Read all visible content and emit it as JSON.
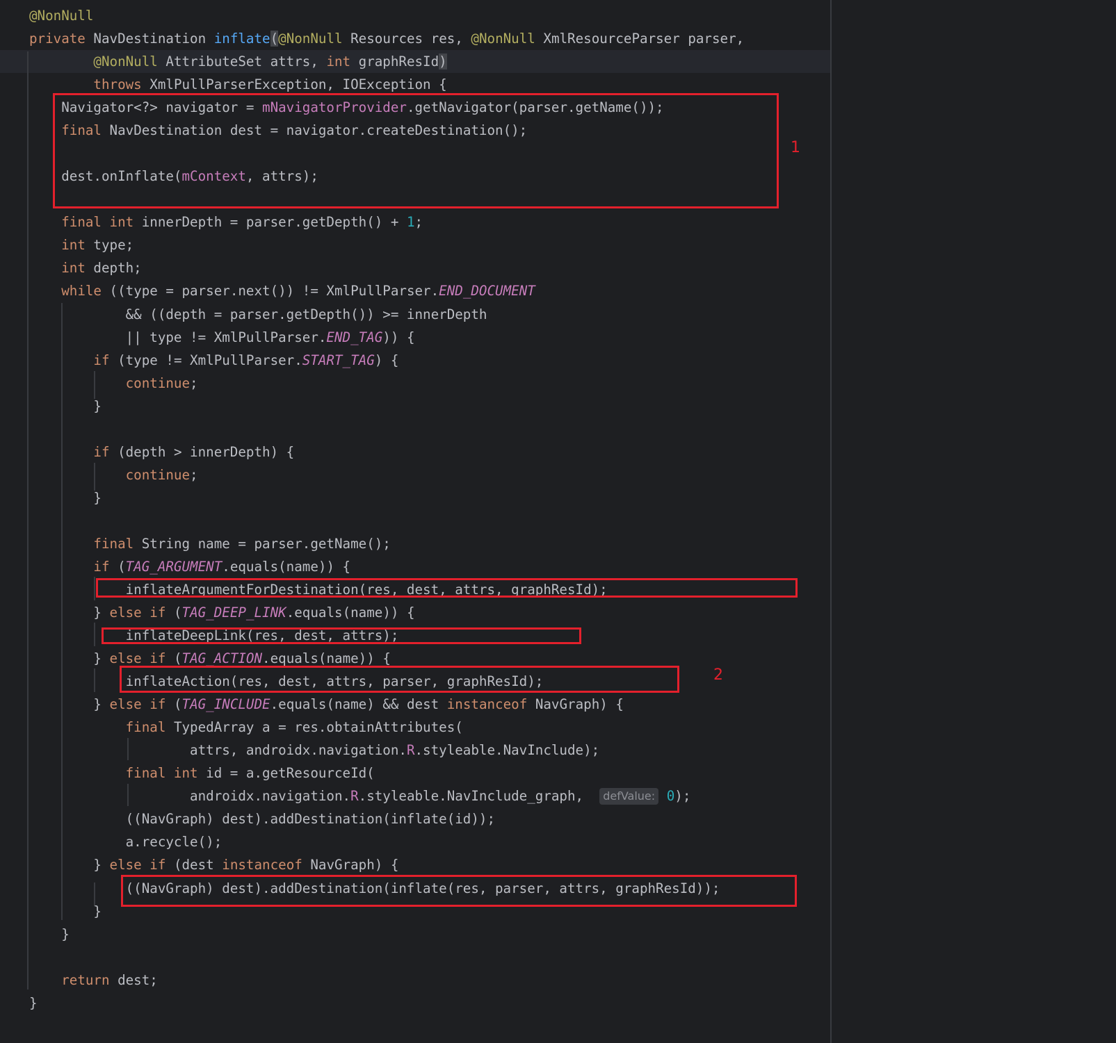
{
  "colors": {
    "background": "#1e1f22",
    "text": "#bcbec4",
    "keyword": "#cf8e6d",
    "annotation": "#b3ae60",
    "method_declaration": "#56a8f5",
    "field": "#c77dbb",
    "number": "#2aacb8",
    "annotation_box": "#e3202c"
  },
  "code": {
    "lines": [
      [
        {
          "t": "@NonNull",
          "c": "ann"
        }
      ],
      [
        {
          "t": "private",
          "c": "kw"
        },
        {
          "t": " NavDestination "
        },
        {
          "t": "inflate",
          "c": "fn"
        },
        {
          "t": "(",
          "c": "brace"
        },
        {
          "t": "@NonNull",
          "c": "ann"
        },
        {
          "t": " Resources res, "
        },
        {
          "t": "@NonNull",
          "c": "ann"
        },
        {
          "t": " XmlResourceParser parser,"
        }
      ],
      [
        {
          "t": "        "
        },
        {
          "t": "@NonNull",
          "c": "ann"
        },
        {
          "t": " AttributeSet attrs, "
        },
        {
          "t": "int",
          "c": "kw"
        },
        {
          "t": " graphResId"
        },
        {
          "t": ")",
          "c": "brace"
        }
      ],
      [
        {
          "t": "        "
        },
        {
          "t": "throws",
          "c": "kw"
        },
        {
          "t": " XmlPullParserException, IOException {"
        }
      ],
      [
        {
          "t": "    Navigator<?> navigator = "
        },
        {
          "t": "mNavigatorProvider",
          "c": "fld"
        },
        {
          "t": ".getNavigator(parser.getName());"
        }
      ],
      [
        {
          "t": "    "
        },
        {
          "t": "final",
          "c": "kw"
        },
        {
          "t": " NavDestination dest = navigator.createDestination();"
        }
      ],
      [],
      [
        {
          "t": "    dest.onInflate("
        },
        {
          "t": "mContext",
          "c": "fld"
        },
        {
          "t": ", attrs);"
        }
      ],
      [],
      [
        {
          "t": "    "
        },
        {
          "t": "final int",
          "c": "kw"
        },
        {
          "t": " innerDepth = parser.getDepth() + "
        },
        {
          "t": "1",
          "c": "num"
        },
        {
          "t": ";"
        }
      ],
      [
        {
          "t": "    "
        },
        {
          "t": "int",
          "c": "kw"
        },
        {
          "t": " type;"
        }
      ],
      [
        {
          "t": "    "
        },
        {
          "t": "int",
          "c": "kw"
        },
        {
          "t": " depth;"
        }
      ],
      [
        {
          "t": "    "
        },
        {
          "t": "while",
          "c": "kw"
        },
        {
          "t": " ((type = parser.next()) != XmlPullParser."
        },
        {
          "t": "END_DOCUMENT",
          "c": "sf"
        }
      ],
      [
        {
          "t": "            && ((depth = parser.getDepth()) >= innerDepth"
        }
      ],
      [
        {
          "t": "            || type != XmlPullParser."
        },
        {
          "t": "END_TAG",
          "c": "sf"
        },
        {
          "t": ")) {"
        }
      ],
      [
        {
          "t": "        "
        },
        {
          "t": "if",
          "c": "kw"
        },
        {
          "t": " (type != XmlPullParser."
        },
        {
          "t": "START_TAG",
          "c": "sf"
        },
        {
          "t": ") {"
        }
      ],
      [
        {
          "t": "            "
        },
        {
          "t": "continue",
          "c": "kw"
        },
        {
          "t": ";"
        }
      ],
      [
        {
          "t": "        }"
        }
      ],
      [],
      [
        {
          "t": "        "
        },
        {
          "t": "if",
          "c": "kw"
        },
        {
          "t": " (depth > innerDepth) {"
        }
      ],
      [
        {
          "t": "            "
        },
        {
          "t": "continue",
          "c": "kw"
        },
        {
          "t": ";"
        }
      ],
      [
        {
          "t": "        }"
        }
      ],
      [],
      [
        {
          "t": "        "
        },
        {
          "t": "final",
          "c": "kw"
        },
        {
          "t": " String name = parser.getName();"
        }
      ],
      [
        {
          "t": "        "
        },
        {
          "t": "if",
          "c": "kw"
        },
        {
          "t": " ("
        },
        {
          "t": "TAG_ARGUMENT",
          "c": "sf"
        },
        {
          "t": ".equals(name)) {"
        }
      ],
      [
        {
          "t": "            inflateArgumentForDestination(res, dest, attrs, graphResId);"
        }
      ],
      [
        {
          "t": "        } "
        },
        {
          "t": "else if",
          "c": "kw"
        },
        {
          "t": " ("
        },
        {
          "t": "TAG_DEEP_LINK",
          "c": "sf"
        },
        {
          "t": ".equals(name)) {"
        }
      ],
      [
        {
          "t": "            inflateDeepLink(res, dest, attrs);"
        }
      ],
      [
        {
          "t": "        } "
        },
        {
          "t": "else if",
          "c": "kw"
        },
        {
          "t": " ("
        },
        {
          "t": "TAG_ACTION",
          "c": "sf"
        },
        {
          "t": ".equals(name)) {"
        }
      ],
      [
        {
          "t": "            inflateAction(res, dest, attrs, parser, graphResId);"
        }
      ],
      [
        {
          "t": "        } "
        },
        {
          "t": "else if",
          "c": "kw"
        },
        {
          "t": " ("
        },
        {
          "t": "TAG_INCLUDE",
          "c": "sf"
        },
        {
          "t": ".equals(name) && dest "
        },
        {
          "t": "instanceof",
          "c": "kw"
        },
        {
          "t": " NavGraph) {"
        }
      ],
      [
        {
          "t": "            "
        },
        {
          "t": "final",
          "c": "kw"
        },
        {
          "t": " TypedArray a = res.obtainAttributes("
        }
      ],
      [
        {
          "t": "                    attrs, androidx.navigation."
        },
        {
          "t": "R",
          "c": "fld"
        },
        {
          "t": ".styleable.NavInclude);"
        }
      ],
      [
        {
          "t": "            "
        },
        {
          "t": "final int",
          "c": "kw"
        },
        {
          "t": " id = a.getResourceId("
        }
      ],
      [
        {
          "t": "                    androidx.navigation."
        },
        {
          "t": "R",
          "c": "fld"
        },
        {
          "t": ".styleable.NavInclude_graph,  "
        },
        {
          "t": "defValue:",
          "c": "hint"
        },
        {
          "t": " "
        },
        {
          "t": "0",
          "c": "num"
        },
        {
          "t": ");"
        }
      ],
      [
        {
          "t": "            ((NavGraph) dest).addDestination(inflate(id));"
        }
      ],
      [
        {
          "t": "            a.recycle();"
        }
      ],
      [
        {
          "t": "        } "
        },
        {
          "t": "else if",
          "c": "kw"
        },
        {
          "t": " (dest "
        },
        {
          "t": "instanceof",
          "c": "kw"
        },
        {
          "t": " NavGraph) {"
        }
      ],
      [
        {
          "t": "            ((NavGraph) dest).addDestination(inflate(res, parser, attrs, graphResId));"
        }
      ],
      [
        {
          "t": "        }"
        }
      ],
      [
        {
          "t": "    }"
        }
      ],
      [],
      [
        {
          "t": "    "
        },
        {
          "t": "return",
          "c": "kw"
        },
        {
          "t": " dest;"
        }
      ],
      [
        {
          "t": "}"
        }
      ]
    ]
  },
  "annotations": {
    "label_1": "1",
    "label_2": "2"
  }
}
